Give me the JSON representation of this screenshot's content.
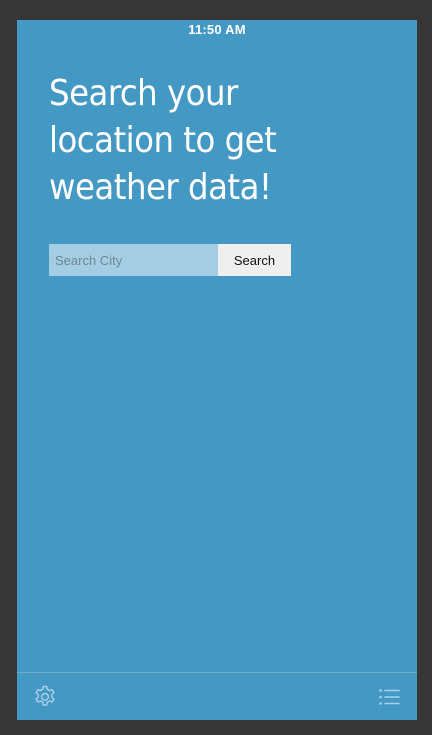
{
  "status_bar": {
    "time": "11:50 AM"
  },
  "headline": {
    "lines": [
      "Search your",
      "location to get",
      "weather data!"
    ]
  },
  "search": {
    "placeholder": "Search City",
    "value": "",
    "button_label": "Search"
  },
  "bottom_bar": {
    "left_icon": "gear-icon",
    "right_icon": "list-icon"
  },
  "colors": {
    "frame": "#363636",
    "screen_background": "#4498c4",
    "input_background": "#a4cde3",
    "button_background": "#efefef",
    "icon_stroke": "#a9d2e8"
  }
}
